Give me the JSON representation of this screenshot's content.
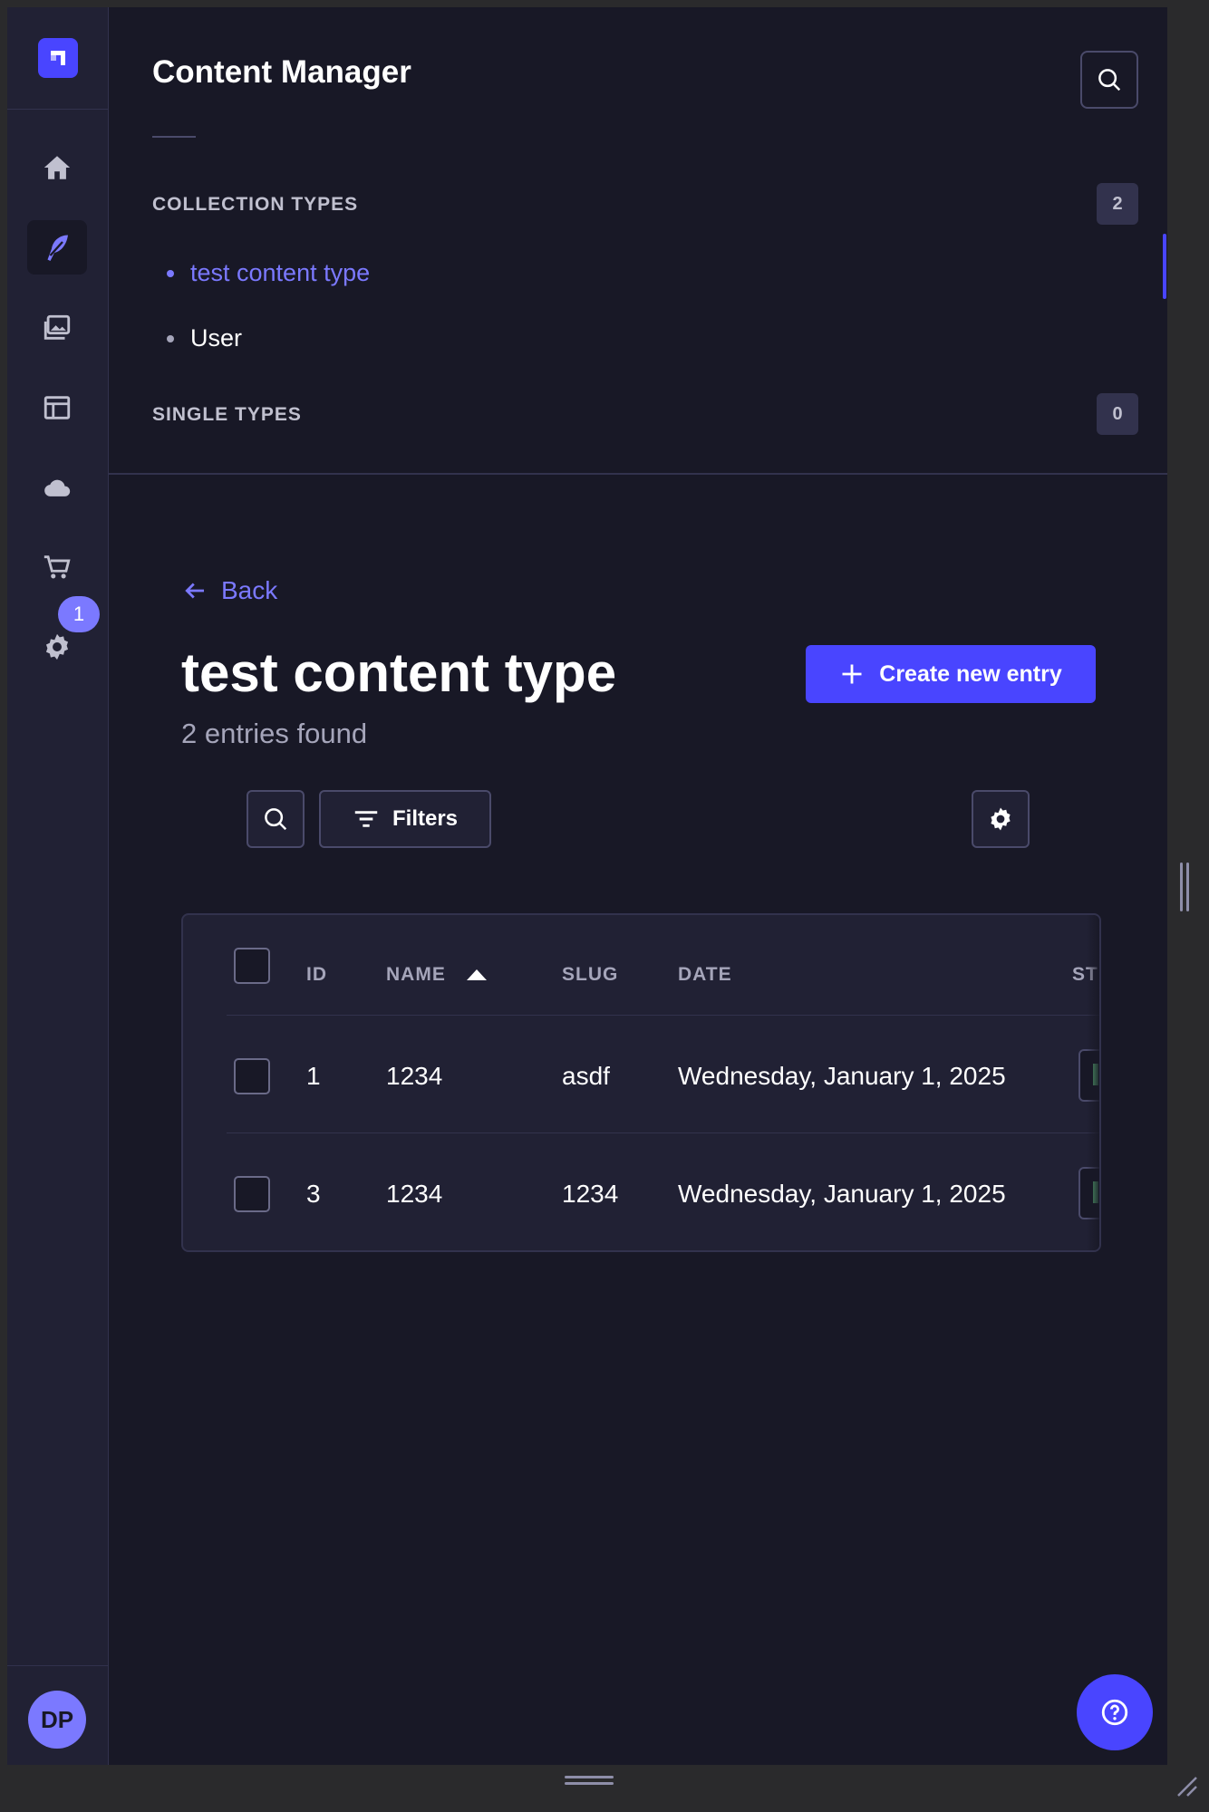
{
  "sidebar_rail": {
    "items": [
      {
        "name": "home"
      },
      {
        "name": "content-manager",
        "active": true
      },
      {
        "name": "media-library"
      },
      {
        "name": "content-type-builder"
      },
      {
        "name": "deploy"
      },
      {
        "name": "marketplace"
      },
      {
        "name": "settings",
        "badge": "1"
      }
    ],
    "avatar_initials": "DP"
  },
  "content_manager": {
    "title": "Content Manager",
    "collection_types_label": "COLLECTION TYPES",
    "collection_types_count": "2",
    "collection_types": [
      {
        "label": "test content type",
        "active": true
      },
      {
        "label": "User",
        "active": false
      }
    ],
    "single_types_label": "SINGLE TYPES",
    "single_types_count": "0"
  },
  "main": {
    "back_label": "Back",
    "title": "test content type",
    "subtitle": "2 entries found",
    "create_button_label": "Create new entry",
    "filters_label": "Filters"
  },
  "table": {
    "columns": [
      "ID",
      "NAME",
      "SLUG",
      "DATE",
      "ST"
    ],
    "sorted_column": "NAME",
    "sort_direction": "ascending",
    "rows": [
      {
        "id": "1",
        "name": "1234",
        "slug": "asdf",
        "date": "Wednesday, January 1, 2025"
      },
      {
        "id": "3",
        "name": "1234",
        "slug": "1234",
        "date": "Wednesday, January 1, 2025"
      }
    ]
  },
  "colors": {
    "background": "#181826",
    "panel": "#212134",
    "accent": "#4945ff",
    "accent_light": "#7b79ff",
    "border": "#32324d",
    "muted_text": "#a5a5ba"
  }
}
